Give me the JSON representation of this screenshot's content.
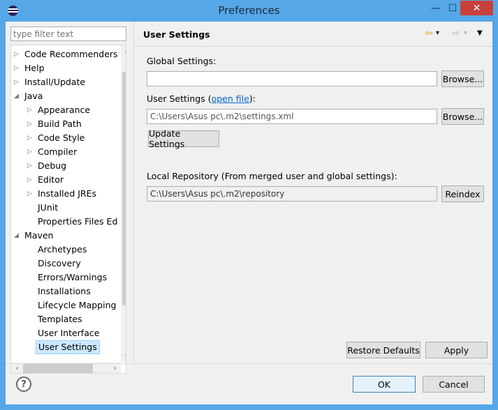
{
  "window": {
    "title": "Preferences",
    "minimize": "—",
    "maximize": "☐",
    "close": "✕"
  },
  "filter": {
    "placeholder": "type filter text"
  },
  "tree": {
    "items": [
      {
        "label": "Code Recommenders",
        "level": 1,
        "expander": "collapsed"
      },
      {
        "label": "Help",
        "level": 1,
        "expander": "collapsed"
      },
      {
        "label": "Install/Update",
        "level": 1,
        "expander": "collapsed"
      },
      {
        "label": "Java",
        "level": 1,
        "expander": "expanded"
      },
      {
        "label": "Appearance",
        "level": 2,
        "expander": "collapsed"
      },
      {
        "label": "Build Path",
        "level": 2,
        "expander": "collapsed"
      },
      {
        "label": "Code Style",
        "level": 2,
        "expander": "collapsed"
      },
      {
        "label": "Compiler",
        "level": 2,
        "expander": "collapsed"
      },
      {
        "label": "Debug",
        "level": 2,
        "expander": "collapsed"
      },
      {
        "label": "Editor",
        "level": 2,
        "expander": "collapsed"
      },
      {
        "label": "Installed JREs",
        "level": 2,
        "expander": "collapsed"
      },
      {
        "label": "JUnit",
        "level": 2,
        "expander": "none"
      },
      {
        "label": "Properties Files Ed",
        "level": 2,
        "expander": "none"
      },
      {
        "label": "Maven",
        "level": 1,
        "expander": "expanded"
      },
      {
        "label": "Archetypes",
        "level": 2,
        "expander": "none"
      },
      {
        "label": "Discovery",
        "level": 2,
        "expander": "none"
      },
      {
        "label": "Errors/Warnings",
        "level": 2,
        "expander": "none"
      },
      {
        "label": "Installations",
        "level": 2,
        "expander": "none"
      },
      {
        "label": "Lifecycle Mapping",
        "level": 2,
        "expander": "none"
      },
      {
        "label": "Templates",
        "level": 2,
        "expander": "none"
      },
      {
        "label": "User Interface",
        "level": 2,
        "expander": "none"
      },
      {
        "label": "User Settings",
        "level": 2,
        "expander": "none",
        "selected": true
      }
    ]
  },
  "page": {
    "title": "User Settings",
    "global_label": "Global Settings:",
    "global_value": "",
    "user_label": "User Settings (",
    "user_link": "open file",
    "user_label_end": "):",
    "user_value": "C:\\Users\\Asus  pc\\.m2\\settings.xml",
    "browse_label": "Browse...",
    "update_label": "Update Settings",
    "repo_label": "Local Repository (From merged user and global settings):",
    "repo_value": "C:\\Users\\Asus  pc\\.m2\\repository",
    "reindex_label": "Reindex",
    "restore_label": "Restore Defaults",
    "apply_label": "Apply"
  },
  "dialog": {
    "help": "?",
    "ok_label": "OK",
    "cancel_label": "Cancel"
  },
  "icons": {
    "back": "⇦",
    "forward": "⇨",
    "dropdown": "▾",
    "menu": "▼",
    "tri_collapsed": "▷",
    "tri_expanded": "◢",
    "scroll_up": "∧",
    "scroll_down": "∨",
    "scroll_left": "‹",
    "scroll_right": "›"
  },
  "colors": {
    "titlebar": "#56a7e8",
    "close": "#c7403a",
    "link": "#0066cc",
    "selection": "#cde8ff"
  }
}
